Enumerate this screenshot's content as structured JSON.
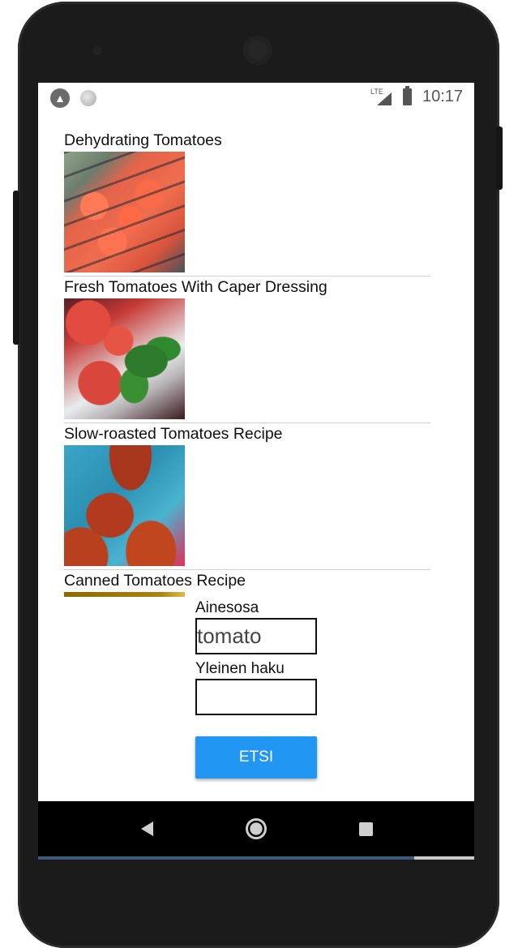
{
  "status_bar": {
    "time": "10:17",
    "network_label": "LTE",
    "left_icons": [
      "app-notification-icon",
      "status-dot-icon"
    ],
    "right_icons": [
      "signal-icon",
      "battery-icon"
    ]
  },
  "recipes": [
    {
      "title": "Dehydrating Tomatoes",
      "image_icon": "dehydrated-tomatoes-photo"
    },
    {
      "title": "Fresh Tomatoes With Caper Dressing",
      "image_icon": "caper-tomatoes-photo"
    },
    {
      "title": "Slow-roasted Tomatoes Recipe",
      "image_icon": "roasted-tomatoes-photo"
    },
    {
      "title": "Canned Tomatoes Recipe",
      "image_icon": "canned-tomatoes-photo"
    }
  ],
  "search_form": {
    "ingredient_label": "Ainesosa",
    "ingredient_value": "tomato",
    "general_label": "Yleinen haku",
    "general_value": "",
    "submit_label": "ETSI"
  },
  "colors": {
    "accent": "#2196f3",
    "device_body": "#1b1b1b",
    "nav_bar": "#000000"
  },
  "nav_bar": {
    "icons": [
      "back-icon",
      "home-icon",
      "recent-apps-icon"
    ]
  }
}
